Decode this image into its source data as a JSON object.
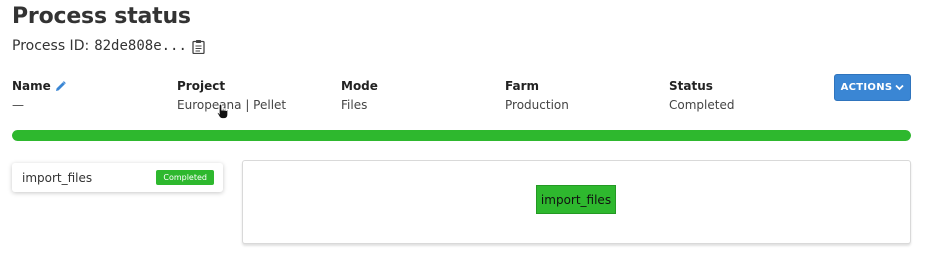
{
  "header": {
    "title": "Process status",
    "process_id_label": "Process ID:",
    "process_id_value": "82de808e..."
  },
  "fields": {
    "name": {
      "label": "Name",
      "value": "—"
    },
    "project": {
      "label": "Project",
      "value": "Europeana | Pellet"
    },
    "mode": {
      "label": "Mode",
      "value": "Files"
    },
    "farm": {
      "label": "Farm",
      "value": "Production"
    },
    "status": {
      "label": "Status",
      "value": "Completed"
    }
  },
  "actions": {
    "label": "ACTIONS"
  },
  "progress": {
    "percent": 100,
    "color": "#2eb82e"
  },
  "tasks": [
    {
      "name": "import_files",
      "status": "Completed"
    }
  ],
  "graph": {
    "nodes": [
      {
        "label": "import_files"
      }
    ]
  },
  "colors": {
    "accent": "#3a86d4",
    "success": "#2eb82e"
  },
  "icons": {
    "copy": "clipboard-icon",
    "edit": "pencil-icon",
    "dropdown": "chevron-down-icon",
    "pointer": "hand-cursor-icon"
  }
}
